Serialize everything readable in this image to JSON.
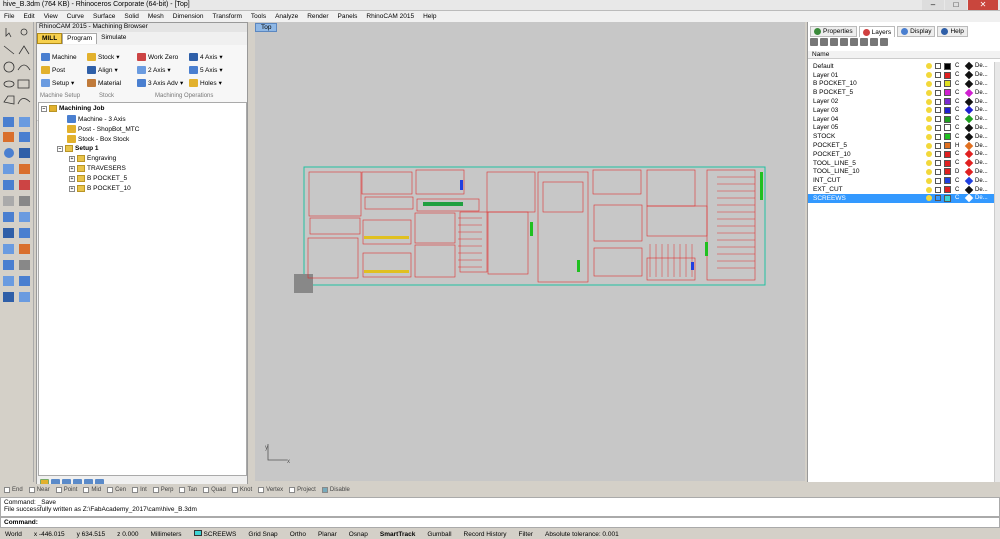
{
  "window": {
    "title": "hive_B.3dm (764 KB) - Rhinoceros Corporate (64-bit) - [Top]"
  },
  "menu": [
    "File",
    "Edit",
    "View",
    "Curve",
    "Surface",
    "Solid",
    "Mesh",
    "Dimension",
    "Transform",
    "Tools",
    "Analyze",
    "Render",
    "Panels",
    "RhinoCAM 2015",
    "Help"
  ],
  "browser": {
    "title": "RhinoCAM 2015 - Machining Browser",
    "tabs": {
      "mill": "MILL",
      "program": "Program",
      "simulate": "Simulate"
    },
    "ribbon": {
      "machine": "Machine",
      "post": "Post",
      "setup": "Setup",
      "stock": "Stock",
      "align": "Align",
      "material": "Material",
      "work_zero": "Work Zero",
      "axis2": "2 Axis",
      "axis3adv": "3 Axis Adv",
      "axis4": "4 Axis",
      "axis5": "5 Axis",
      "holes": "Holes",
      "groups": {
        "machine_setup": "Machine Setup",
        "stock": "Stock",
        "ops": "Machining Operations"
      }
    },
    "tree": {
      "job": "Machining Job",
      "machine": "Machine - 3 Axis",
      "post": "Post - ShopBot_MTC",
      "stock": "Stock - Box Stock",
      "setup": "Setup 1",
      "items": [
        "Engraving",
        "TRAVESERS",
        "B POCKET_5",
        "B POCKET_10"
      ]
    }
  },
  "viewport": {
    "label": "Top"
  },
  "right_panel": {
    "tabs": {
      "properties": "Properties",
      "layers": "Layers",
      "display": "Display",
      "help": "Help"
    },
    "header_name": "Name",
    "layers": [
      {
        "name": "Default",
        "color": "#000000",
        "mat": "C",
        "dia": "#111111",
        "lt": "De..."
      },
      {
        "name": "Layer 01",
        "color": "#e02020",
        "mat": "C",
        "dia": "#111111",
        "lt": "De..."
      },
      {
        "name": "B POCKET_10",
        "color": "#e0e020",
        "mat": "C",
        "dia": "#111111",
        "lt": "De..."
      },
      {
        "name": "B POCKET_5",
        "color": "#d020d0",
        "mat": "C",
        "dia": "#d020d0",
        "lt": "De..."
      },
      {
        "name": "Layer 02",
        "color": "#7a2ad0",
        "mat": "C",
        "dia": "#111111",
        "lt": "De..."
      },
      {
        "name": "Layer 03",
        "color": "#2020d0",
        "mat": "C",
        "dia": "#2020d0",
        "lt": "De..."
      },
      {
        "name": "Layer 04",
        "color": "#20a020",
        "mat": "C",
        "dia": "#20a020",
        "lt": "De..."
      },
      {
        "name": "Layer 05",
        "color": "#ffffff",
        "mat": "C",
        "dia": "#111111",
        "lt": "De..."
      },
      {
        "name": "STOCK",
        "color": "#20c020",
        "mat": "C",
        "dia": "#111111",
        "lt": "De..."
      },
      {
        "name": "POCKET_5",
        "color": "#e07020",
        "mat": "H",
        "dia": "#e07020",
        "lt": "De..."
      },
      {
        "name": "POCKET_10",
        "color": "#e02020",
        "mat": "C",
        "dia": "#e02020",
        "lt": "De..."
      },
      {
        "name": "TOOL_LINE_5",
        "color": "#e02020",
        "mat": "C",
        "dia": "#e02020",
        "lt": "De..."
      },
      {
        "name": "TOOL_LINE_10",
        "color": "#e02020",
        "mat": "D",
        "dia": "#e02020",
        "lt": "De..."
      },
      {
        "name": "INT_CUT",
        "color": "#2040e0",
        "mat": "C",
        "dia": "#2040e0",
        "lt": "De..."
      },
      {
        "name": "EXT_CUT",
        "color": "#e02020",
        "mat": "C",
        "dia": "#111111",
        "lt": "De..."
      },
      {
        "name": "SCREEWS",
        "color": "#3cd4d4",
        "mat": "C",
        "dia": "#ffffff",
        "lt": "De..."
      }
    ]
  },
  "snaps": [
    {
      "label": "End",
      "on": false
    },
    {
      "label": "Near",
      "on": false
    },
    {
      "label": "Point",
      "on": false
    },
    {
      "label": "Mid",
      "on": false
    },
    {
      "label": "Cen",
      "on": false
    },
    {
      "label": "Int",
      "on": false
    },
    {
      "label": "Perp",
      "on": false
    },
    {
      "label": "Tan",
      "on": false
    },
    {
      "label": "Quad",
      "on": false
    },
    {
      "label": "Knot",
      "on": false
    },
    {
      "label": "Vertex",
      "on": false
    },
    {
      "label": "Project",
      "on": false
    },
    {
      "label": "Disable",
      "on": true
    }
  ],
  "command": {
    "history1": "Command: _Save",
    "history2": "File successfully written as Z:\\FabAcademy_2017\\cam\\hive_B.3dm",
    "prompt": "Command:"
  },
  "status": {
    "cplane": "World",
    "x": "x -446.015",
    "y": "y 634.515",
    "z": "z 0.000",
    "units": "Millimeters",
    "layer": "SCREEWS",
    "grid": "Grid Snap",
    "ortho": "Ortho",
    "planar": "Planar",
    "osnap": "Osnap",
    "smarttrack": "SmartTrack",
    "gumball": "Gumball",
    "history": "Record History",
    "filter": "Filter",
    "tolerance": "Absolute tolerance: 0.001"
  }
}
